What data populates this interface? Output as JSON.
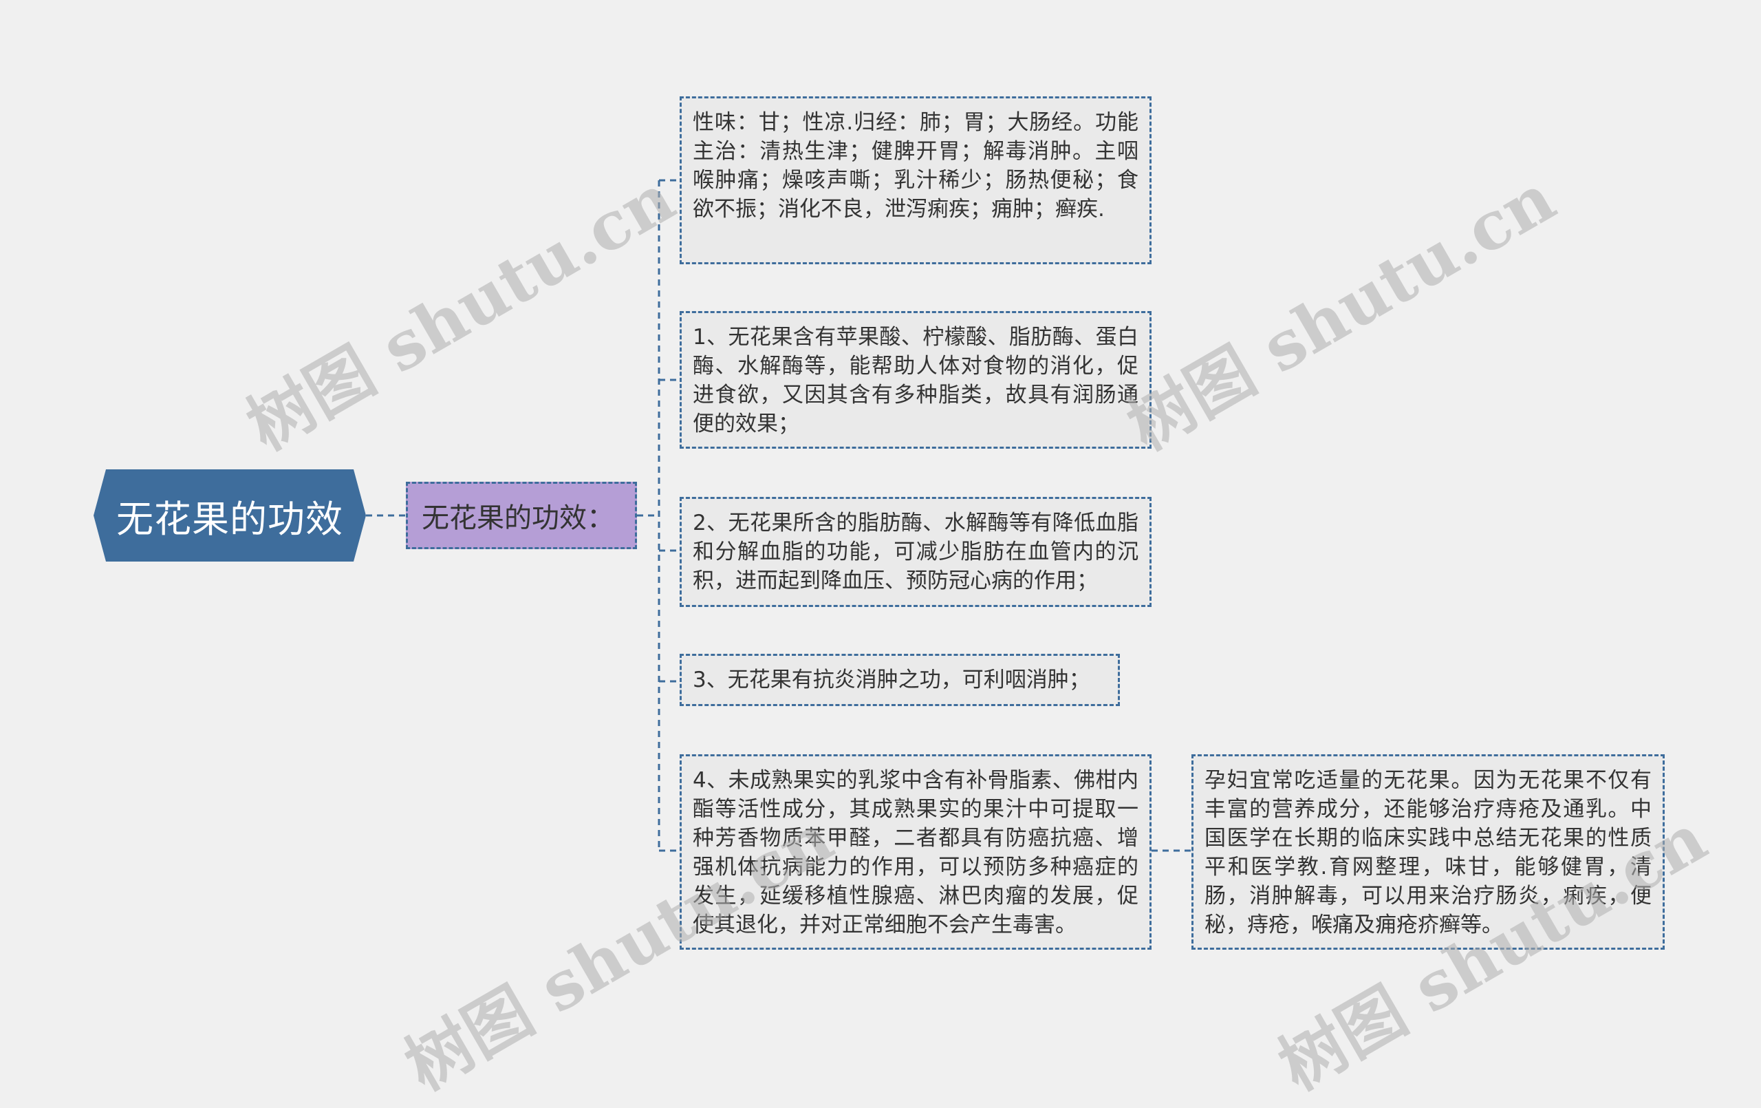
{
  "root": {
    "label": "无花果的功效"
  },
  "branch": {
    "label": "无花果的功效："
  },
  "leaves": [
    {
      "text": "性味：甘；性凉.归经：肺；胃；大肠经。功能主治：清热生津；健脾开胃；解毒消肿。主咽喉肿痛；燥咳声嘶；乳汁稀少；肠热便秘；食欲不振；消化不良，泄泻痢疾；痈肿；癣疾."
    },
    {
      "text": "1、无花果含有苹果酸、柠檬酸、脂肪酶、蛋白酶、水解酶等，能帮助人体对食物的消化，促进食欲，又因其含有多种脂类，故具有润肠通便的效果；"
    },
    {
      "text": "2、无花果所含的脂肪酶、水解酶等有降低血脂和分解血脂的功能，可减少脂肪在血管内的沉积，进而起到降血压、预防冠心病的作用；"
    },
    {
      "text": "3、无花果有抗炎消肿之功，可利咽消肿；"
    },
    {
      "text": "4、未成熟果实的乳浆中含有补骨脂素、佛柑内酯等活性成分，其成熟果实的果汁中可提取一种芳香物质苯甲醛，二者都具有防癌抗癌、增强机体抗病能力的作用，可以预防多种癌症的发生，延缓移植性腺癌、淋巴肉瘤的发展，促使其退化，并对正常细胞不会产生毒害。"
    }
  ],
  "sub_leaf": {
    "text": "孕妇宜常吃适量的无花果。因为无花果不仅有丰富的营养成分，还能够治疗痔疮及通乳。中国医学在长期的临床实践中总结无花果的性质平和医学教.育网整理，味甘，能够健胃，清肠，消肿解毒，可以用来治疗肠炎，痢疾，便秘，痔疮，喉痛及痈疮疥癣等。"
  },
  "watermarks": [
    "树图 shutu.cn",
    "树图 shutu.cn",
    "树图 shutu.cn",
    "树图 shutu.cn"
  ],
  "colors": {
    "root_fill": "#3e6d9c",
    "branch_fill": "#b59ed6",
    "leaf_fill": "#eaeaea",
    "connector": "#3e6d9c",
    "background": "#f0f0f0"
  }
}
